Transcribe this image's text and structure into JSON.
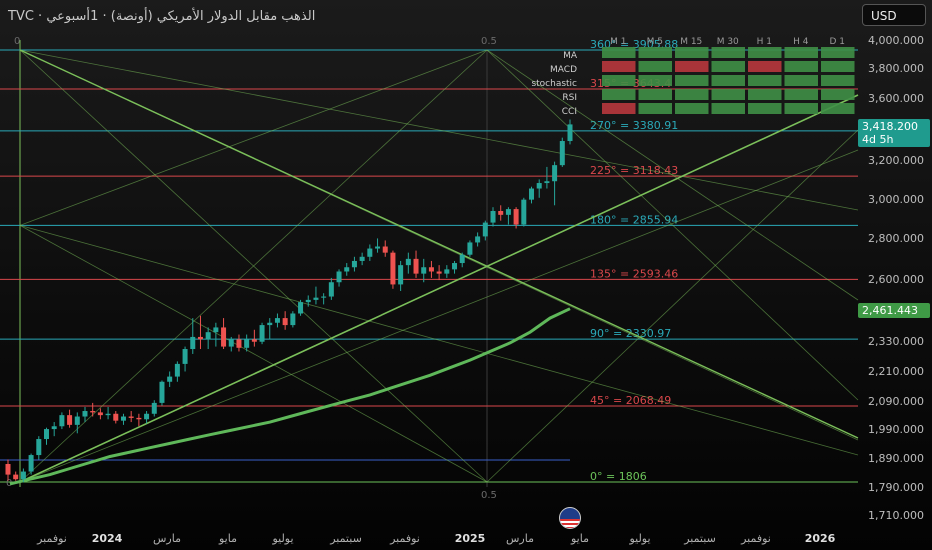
{
  "header": {
    "title": "TVC · الذهب مقابل الدولار الأمريكي (أونصة) · 1أسبوعي",
    "currency_button": "USD"
  },
  "price_tags": {
    "last_price": "3,418.200",
    "countdown": "4d 5h",
    "ma_value": "2,461.443"
  },
  "colors": {
    "bullish": "#26a69a",
    "bearish": "#ef5350",
    "ma_line": "#5fb85a",
    "teal_level": "#2aa9b8",
    "red_level": "#d9474b",
    "green_level": "#6cc35a",
    "gann_line": "#7bbf5a"
  },
  "indicator_table": {
    "timeframes": [
      "M 1",
      "M 5",
      "M 15",
      "M 30",
      "H 1",
      "H 4",
      "D 1"
    ],
    "rows": [
      {
        "name": "MA",
        "signals": [
          "buy",
          "buy",
          "buy",
          "buy",
          "buy",
          "buy",
          "buy"
        ]
      },
      {
        "name": "MACD",
        "signals": [
          "sell",
          "buy",
          "sell",
          "buy",
          "sell",
          "buy",
          "buy"
        ]
      },
      {
        "name": "stochastic",
        "signals": [
          "buy",
          "buy",
          "buy",
          "buy",
          "buy",
          "buy",
          "buy"
        ]
      },
      {
        "name": "RSI",
        "signals": [
          "buy",
          "buy",
          "buy",
          "buy",
          "buy",
          "buy",
          "buy"
        ]
      },
      {
        "name": "CCI",
        "signals": [
          "sell",
          "buy",
          "buy",
          "buy",
          "buy",
          "buy",
          "buy"
        ]
      }
    ]
  },
  "chart_data": {
    "type": "candlestick",
    "ylim": [
      1700,
      4060
    ],
    "y_scale": "log",
    "y_ticks": [
      "4,000.000",
      "3,800.000",
      "3,600.000",
      "3,400.000",
      "3,200.000",
      "3,000.000",
      "2,800.000",
      "2,600.000",
      "2,470.000",
      "2,330.000",
      "2,210.000",
      "2,090.000",
      "1,990.000",
      "1,890.000",
      "1,790.000",
      "1,710.000"
    ],
    "x_ticks": [
      "نوفمبر",
      "2024",
      "مارس",
      "مايو",
      "يوليو",
      "سبتمبر",
      "نوفمبر",
      "2025",
      "مارس",
      "مايو",
      "يوليو",
      "سبتمبر",
      "نوفمبر",
      "2026"
    ],
    "gann_levels": [
      {
        "label": "360° = 3905.88",
        "value": 3905.88,
        "style": "teal"
      },
      {
        "label": "315° = 3643.4",
        "value": 3643.4,
        "style": "red"
      },
      {
        "label": "270° = 3380.91",
        "value": 3380.91,
        "style": "teal"
      },
      {
        "label": "225° = 3118.43",
        "value": 3118.43,
        "style": "red"
      },
      {
        "label": "180° = 2855.94",
        "value": 2855.94,
        "style": "teal"
      },
      {
        "label": "135° = 2593.46",
        "value": 2593.46,
        "style": "red"
      },
      {
        "label": "90° = 2330.97",
        "value": 2330.97,
        "style": "teal"
      },
      {
        "label": "45° = 2068.49",
        "value": 2068.49,
        "style": "red"
      },
      {
        "label": "0° = 1806",
        "value": 1806,
        "style": "green"
      }
    ],
    "grid_labels": {
      "left_zero": "0",
      "mid_top": "0.5",
      "mid_bottom": "0.5",
      "left_bottom": "0"
    },
    "candles": [
      {
        "o": 1865,
        "h": 1880,
        "l": 1810,
        "c": 1830
      },
      {
        "o": 1830,
        "h": 1840,
        "l": 1810,
        "c": 1815
      },
      {
        "o": 1815,
        "h": 1850,
        "l": 1805,
        "c": 1840
      },
      {
        "o": 1840,
        "h": 1900,
        "l": 1830,
        "c": 1895
      },
      {
        "o": 1895,
        "h": 1960,
        "l": 1880,
        "c": 1950
      },
      {
        "o": 1950,
        "h": 1990,
        "l": 1930,
        "c": 1985
      },
      {
        "o": 1985,
        "h": 2010,
        "l": 1960,
        "c": 1995
      },
      {
        "o": 1995,
        "h": 2045,
        "l": 1985,
        "c": 2035
      },
      {
        "o": 2035,
        "h": 2055,
        "l": 1990,
        "c": 2000
      },
      {
        "o": 2000,
        "h": 2045,
        "l": 1970,
        "c": 2030
      },
      {
        "o": 2030,
        "h": 2065,
        "l": 2010,
        "c": 2050
      },
      {
        "o": 2050,
        "h": 2080,
        "l": 2030,
        "c": 2045
      },
      {
        "o": 2045,
        "h": 2060,
        "l": 2020,
        "c": 2035
      },
      {
        "o": 2035,
        "h": 2065,
        "l": 2020,
        "c": 2040
      },
      {
        "o": 2040,
        "h": 2050,
        "l": 2005,
        "c": 2015
      },
      {
        "o": 2015,
        "h": 2040,
        "l": 2000,
        "c": 2030
      },
      {
        "o": 2030,
        "h": 2050,
        "l": 2010,
        "c": 2025
      },
      {
        "o": 2025,
        "h": 2040,
        "l": 1995,
        "c": 2020
      },
      {
        "o": 2020,
        "h": 2050,
        "l": 2005,
        "c": 2040
      },
      {
        "o": 2040,
        "h": 2090,
        "l": 2030,
        "c": 2080
      },
      {
        "o": 2080,
        "h": 2165,
        "l": 2070,
        "c": 2160
      },
      {
        "o": 2160,
        "h": 2200,
        "l": 2140,
        "c": 2180
      },
      {
        "o": 2180,
        "h": 2240,
        "l": 2160,
        "c": 2230
      },
      {
        "o": 2230,
        "h": 2300,
        "l": 2200,
        "c": 2290
      },
      {
        "o": 2290,
        "h": 2420,
        "l": 2270,
        "c": 2340
      },
      {
        "o": 2340,
        "h": 2430,
        "l": 2290,
        "c": 2330
      },
      {
        "o": 2330,
        "h": 2380,
        "l": 2290,
        "c": 2360
      },
      {
        "o": 2360,
        "h": 2400,
        "l": 2300,
        "c": 2380
      },
      {
        "o": 2380,
        "h": 2420,
        "l": 2290,
        "c": 2300
      },
      {
        "o": 2300,
        "h": 2340,
        "l": 2280,
        "c": 2330
      },
      {
        "o": 2330,
        "h": 2350,
        "l": 2280,
        "c": 2295
      },
      {
        "o": 2295,
        "h": 2350,
        "l": 2280,
        "c": 2330
      },
      {
        "o": 2330,
        "h": 2370,
        "l": 2300,
        "c": 2320
      },
      {
        "o": 2320,
        "h": 2400,
        "l": 2310,
        "c": 2390
      },
      {
        "o": 2390,
        "h": 2420,
        "l": 2330,
        "c": 2400
      },
      {
        "o": 2400,
        "h": 2440,
        "l": 2380,
        "c": 2420
      },
      {
        "o": 2420,
        "h": 2450,
        "l": 2370,
        "c": 2390
      },
      {
        "o": 2390,
        "h": 2450,
        "l": 2380,
        "c": 2440
      },
      {
        "o": 2440,
        "h": 2500,
        "l": 2430,
        "c": 2490
      },
      {
        "o": 2490,
        "h": 2520,
        "l": 2470,
        "c": 2500
      },
      {
        "o": 2500,
        "h": 2560,
        "l": 2480,
        "c": 2510
      },
      {
        "o": 2510,
        "h": 2530,
        "l": 2480,
        "c": 2515
      },
      {
        "o": 2515,
        "h": 2600,
        "l": 2500,
        "c": 2580
      },
      {
        "o": 2580,
        "h": 2640,
        "l": 2560,
        "c": 2630
      },
      {
        "o": 2630,
        "h": 2670,
        "l": 2610,
        "c": 2650
      },
      {
        "o": 2650,
        "h": 2700,
        "l": 2630,
        "c": 2680
      },
      {
        "o": 2680,
        "h": 2720,
        "l": 2660,
        "c": 2700
      },
      {
        "o": 2700,
        "h": 2760,
        "l": 2680,
        "c": 2740
      },
      {
        "o": 2740,
        "h": 2790,
        "l": 2720,
        "c": 2750
      },
      {
        "o": 2750,
        "h": 2780,
        "l": 2700,
        "c": 2720
      },
      {
        "o": 2720,
        "h": 2730,
        "l": 2550,
        "c": 2570
      },
      {
        "o": 2570,
        "h": 2680,
        "l": 2540,
        "c": 2660
      },
      {
        "o": 2660,
        "h": 2720,
        "l": 2620,
        "c": 2690
      },
      {
        "o": 2690,
        "h": 2730,
        "l": 2600,
        "c": 2620
      },
      {
        "o": 2620,
        "h": 2690,
        "l": 2580,
        "c": 2650
      },
      {
        "o": 2650,
        "h": 2680,
        "l": 2600,
        "c": 2630
      },
      {
        "o": 2630,
        "h": 2660,
        "l": 2590,
        "c": 2620
      },
      {
        "o": 2620,
        "h": 2660,
        "l": 2600,
        "c": 2640
      },
      {
        "o": 2640,
        "h": 2680,
        "l": 2620,
        "c": 2670
      },
      {
        "o": 2670,
        "h": 2720,
        "l": 2650,
        "c": 2710
      },
      {
        "o": 2710,
        "h": 2780,
        "l": 2700,
        "c": 2770
      },
      {
        "o": 2770,
        "h": 2820,
        "l": 2750,
        "c": 2800
      },
      {
        "o": 2800,
        "h": 2880,
        "l": 2780,
        "c": 2870
      },
      {
        "o": 2870,
        "h": 2950,
        "l": 2850,
        "c": 2930
      },
      {
        "o": 2930,
        "h": 2960,
        "l": 2880,
        "c": 2910
      },
      {
        "o": 2910,
        "h": 2950,
        "l": 2860,
        "c": 2940
      },
      {
        "o": 2940,
        "h": 2950,
        "l": 2840,
        "c": 2860
      },
      {
        "o": 2860,
        "h": 3000,
        "l": 2850,
        "c": 2990
      },
      {
        "o": 2990,
        "h": 3060,
        "l": 2970,
        "c": 3050
      },
      {
        "o": 3050,
        "h": 3100,
        "l": 3000,
        "c": 3080
      },
      {
        "o": 3080,
        "h": 3170,
        "l": 3050,
        "c": 3090
      },
      {
        "o": 3090,
        "h": 3200,
        "l": 2960,
        "c": 3180
      },
      {
        "o": 3180,
        "h": 3340,
        "l": 3170,
        "c": 3320
      },
      {
        "o": 3320,
        "h": 3450,
        "l": 3300,
        "c": 3420
      }
    ],
    "ma_series": [
      1800,
      1815,
      1830,
      1850,
      1870,
      1890,
      1905,
      1920,
      1935,
      1950,
      1965,
      1980,
      1995,
      2010,
      2030,
      2050,
      2070,
      2090,
      2110,
      2135,
      2160,
      2185,
      2215,
      2245,
      2280,
      2315,
      2360,
      2420,
      2461
    ]
  }
}
